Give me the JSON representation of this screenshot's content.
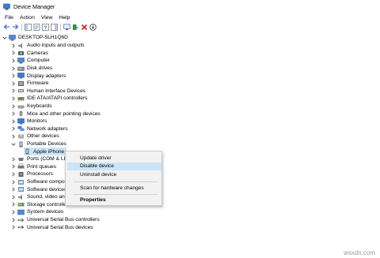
{
  "window": {
    "title": "Device Manager",
    "icon": "device-manager-icon"
  },
  "menu": [
    "File",
    "Action",
    "View",
    "Help"
  ],
  "toolbar": [
    {
      "name": "back-button",
      "icon": "arrow-left-icon"
    },
    {
      "name": "forward-button",
      "icon": "arrow-right-icon"
    },
    {
      "name": "show-hide-console-tree-button",
      "icon": "console-tree-icon"
    },
    {
      "name": "properties-button",
      "icon": "properties-icon"
    },
    {
      "name": "help-button",
      "icon": "help-icon"
    },
    {
      "name": "action-pane-button",
      "icon": "action-pane-icon"
    },
    {
      "name": "scan-hardware-button",
      "icon": "monitor-scan-icon"
    },
    {
      "name": "update-driver-button",
      "icon": "update-driver-icon"
    },
    {
      "name": "uninstall-button",
      "icon": "red-x-icon"
    },
    {
      "name": "disable-button",
      "icon": "disable-icon"
    }
  ],
  "tree": {
    "root": "DESKTOP-5LH1Q6D",
    "items": [
      {
        "label": "Audio inputs and outputs",
        "icon": "speaker-icon"
      },
      {
        "label": "Cameras",
        "icon": "camera-icon"
      },
      {
        "label": "Computer",
        "icon": "computer-icon"
      },
      {
        "label": "Disk drives",
        "icon": "disk-icon"
      },
      {
        "label": "Display adapters",
        "icon": "display-adapter-icon"
      },
      {
        "label": "Firmware",
        "icon": "firmware-icon"
      },
      {
        "label": "Human Interface Devices",
        "icon": "hid-icon"
      },
      {
        "label": "IDE ATA/ATAPI controllers",
        "icon": "ide-icon"
      },
      {
        "label": "Keyboards",
        "icon": "keyboard-icon"
      },
      {
        "label": "Mice and other pointing devices",
        "icon": "mouse-icon"
      },
      {
        "label": "Monitors",
        "icon": "monitor-icon"
      },
      {
        "label": "Network adapters",
        "icon": "network-icon"
      },
      {
        "label": "Other devices",
        "icon": "other-device-icon"
      },
      {
        "label": "Portable Devices",
        "icon": "portable-device-icon"
      },
      {
        "label": "Apple iPhone",
        "icon": "phone-icon"
      },
      {
        "label": "Ports (COM & LP",
        "icon": "port-icon"
      },
      {
        "label": "Print queues",
        "icon": "printer-icon"
      },
      {
        "label": "Processors",
        "icon": "processor-icon"
      },
      {
        "label": "Software compor",
        "icon": "software-component-icon"
      },
      {
        "label": "Software devices",
        "icon": "software-device-icon"
      },
      {
        "label": "Sound, video and",
        "icon": "sound-icon"
      },
      {
        "label": "Storage controlle",
        "icon": "storage-icon"
      },
      {
        "label": "System devices",
        "icon": "system-icon"
      },
      {
        "label": "Universal Serial Bus controllers",
        "icon": "usb-icon"
      },
      {
        "label": "Universal Serial Bus devices",
        "icon": "usb-icon"
      }
    ]
  },
  "context_menu": {
    "items": [
      "Update driver",
      "Disable device",
      "Uninstall device",
      "Scan for hardware changes",
      "Properties"
    ],
    "highlighted": "Disable device",
    "highlight_color": "#cce4f7"
  },
  "watermark": "wsxdn.com",
  "colors": {
    "selection": "#cce4f7",
    "tree_lines": "#808080"
  }
}
